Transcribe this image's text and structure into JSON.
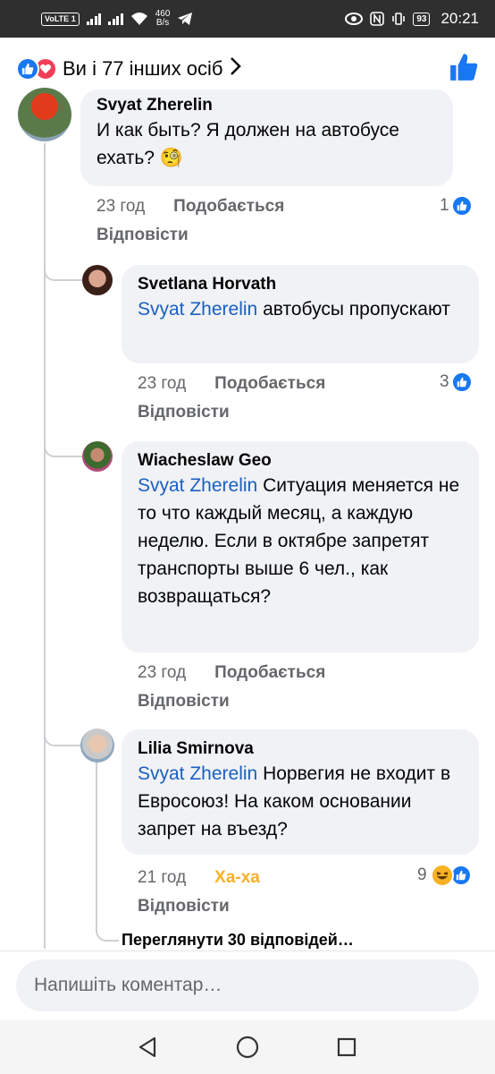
{
  "status_bar": {
    "volte": "VoLTE",
    "sim": "1",
    "speed_value": "460",
    "speed_unit": "B/s",
    "battery": "93",
    "time": "20:21"
  },
  "header": {
    "reactions_text": "Ви і 77 інших осіб",
    "like_icon": "thumbs-up-icon",
    "love_icon": "heart-icon"
  },
  "comments": [
    {
      "author": "Svyat Zherelin",
      "mention": "",
      "text": "И как быть? Я должен на автобусе ехать? 🧐",
      "time": "23 год",
      "action": "Подобається",
      "reply": "Відповісти",
      "reactions": "1"
    },
    {
      "author": "Svetlana Horvath",
      "mention": "Svyat Zherelin",
      "text": " автобусы пропускают",
      "time": "23 год",
      "action": "Подобається",
      "reply": "Відповісти",
      "reactions": "3"
    },
    {
      "author": "Wiacheslaw Geo",
      "mention": "Svyat Zherelin",
      "text": " Ситуация меняется не то что каждый месяц, а каждую неделю. Если в октябре запретят транспорты выше 6 чел., как возвращаться?",
      "time": "23 год",
      "action": "Подобається",
      "reply": "Відповісти",
      "reactions": ""
    },
    {
      "author": "Lilia Smirnova",
      "mention": "Svyat Zherelin",
      "text": " Норвегия не входит в Евросоюз! На каком основании запрет на въезд?",
      "time": "21 год",
      "action": "Ха-ха",
      "reply": "Відповісти",
      "reactions": "9"
    }
  ],
  "view_more": "Переглянути 30 відповідей…",
  "composer": {
    "placeholder": "Напишіть коментар…"
  },
  "colors": {
    "accent": "#1877f2",
    "mention": "#1b5fc1",
    "haha": "#f7b125",
    "bubble": "#f0f2f5"
  }
}
